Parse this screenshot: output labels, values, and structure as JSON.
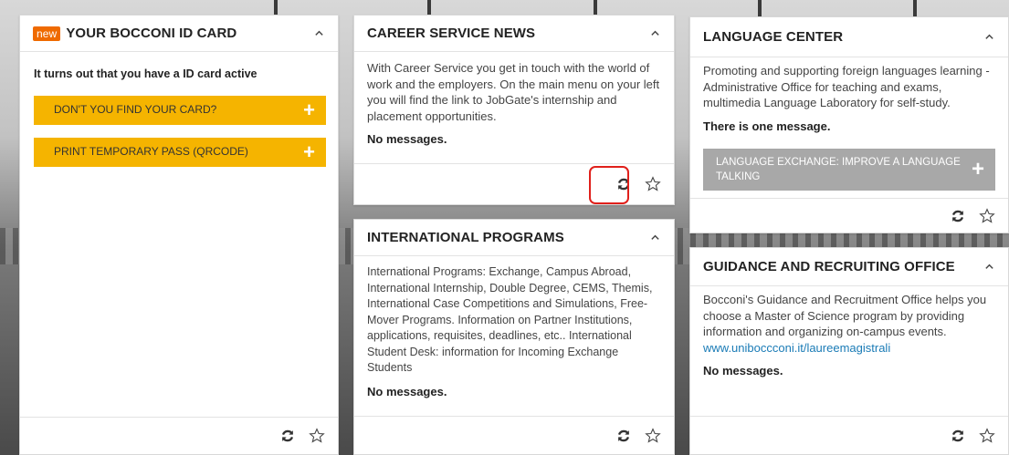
{
  "id_card": {
    "badge": "new",
    "title": "YOUR BOCCONI ID CARD",
    "status_text": "It turns out that you have a ID card active",
    "buttons": [
      {
        "label": "DON'T YOU FIND YOUR CARD?"
      },
      {
        "label": "PRINT TEMPORARY PASS (QRCODE)"
      }
    ]
  },
  "career": {
    "title": "CAREER SERVICE NEWS",
    "description": "With Career Service you get in touch with the world of work and the employers. On the main menu on your left you will find the link to JobGate's internship and placement opportunities.",
    "messages": "No messages."
  },
  "language": {
    "title": "LANGUAGE CENTER",
    "description": "Promoting and supporting foreign languages learning - Administrative Office for teaching and exams, multimedia Language Laboratory for self-study.",
    "messages": "There is one message.",
    "button_label": "LANGUAGE EXCHANGE: IMPROVE A LANGUAGE TALKING"
  },
  "international": {
    "title": "INTERNATIONAL PROGRAMS",
    "description": "International Programs: Exchange, Campus Abroad, International Internship, Double Degree, CEMS, Themis, International Case Competitions and Simulations, Free-Mover Programs. Information on Partner Institutions, applications, requisites, deadlines, etc.. International Student Desk: information for Incoming Exchange Students",
    "messages": "No messages."
  },
  "guidance": {
    "title": "GUIDANCE AND RECRUITING OFFICE",
    "description": "Bocconi's Guidance and Recruitment Office helps you choose a Master of Science program by providing information and organizing on-campus events.",
    "link": "www.uniboccconi.it/laureemagistrali",
    "messages": "No messages."
  },
  "icons": {
    "collapse": "chevron-up-icon",
    "refresh": "refresh-icon",
    "favorite": "star-icon",
    "add": "plus-icon"
  },
  "colors": {
    "badge": "#ef6a00",
    "yellow_button": "#f5b400",
    "grey_button": "#a8a8a8",
    "link": "#1a7bb6",
    "highlight": "#e0201b"
  }
}
